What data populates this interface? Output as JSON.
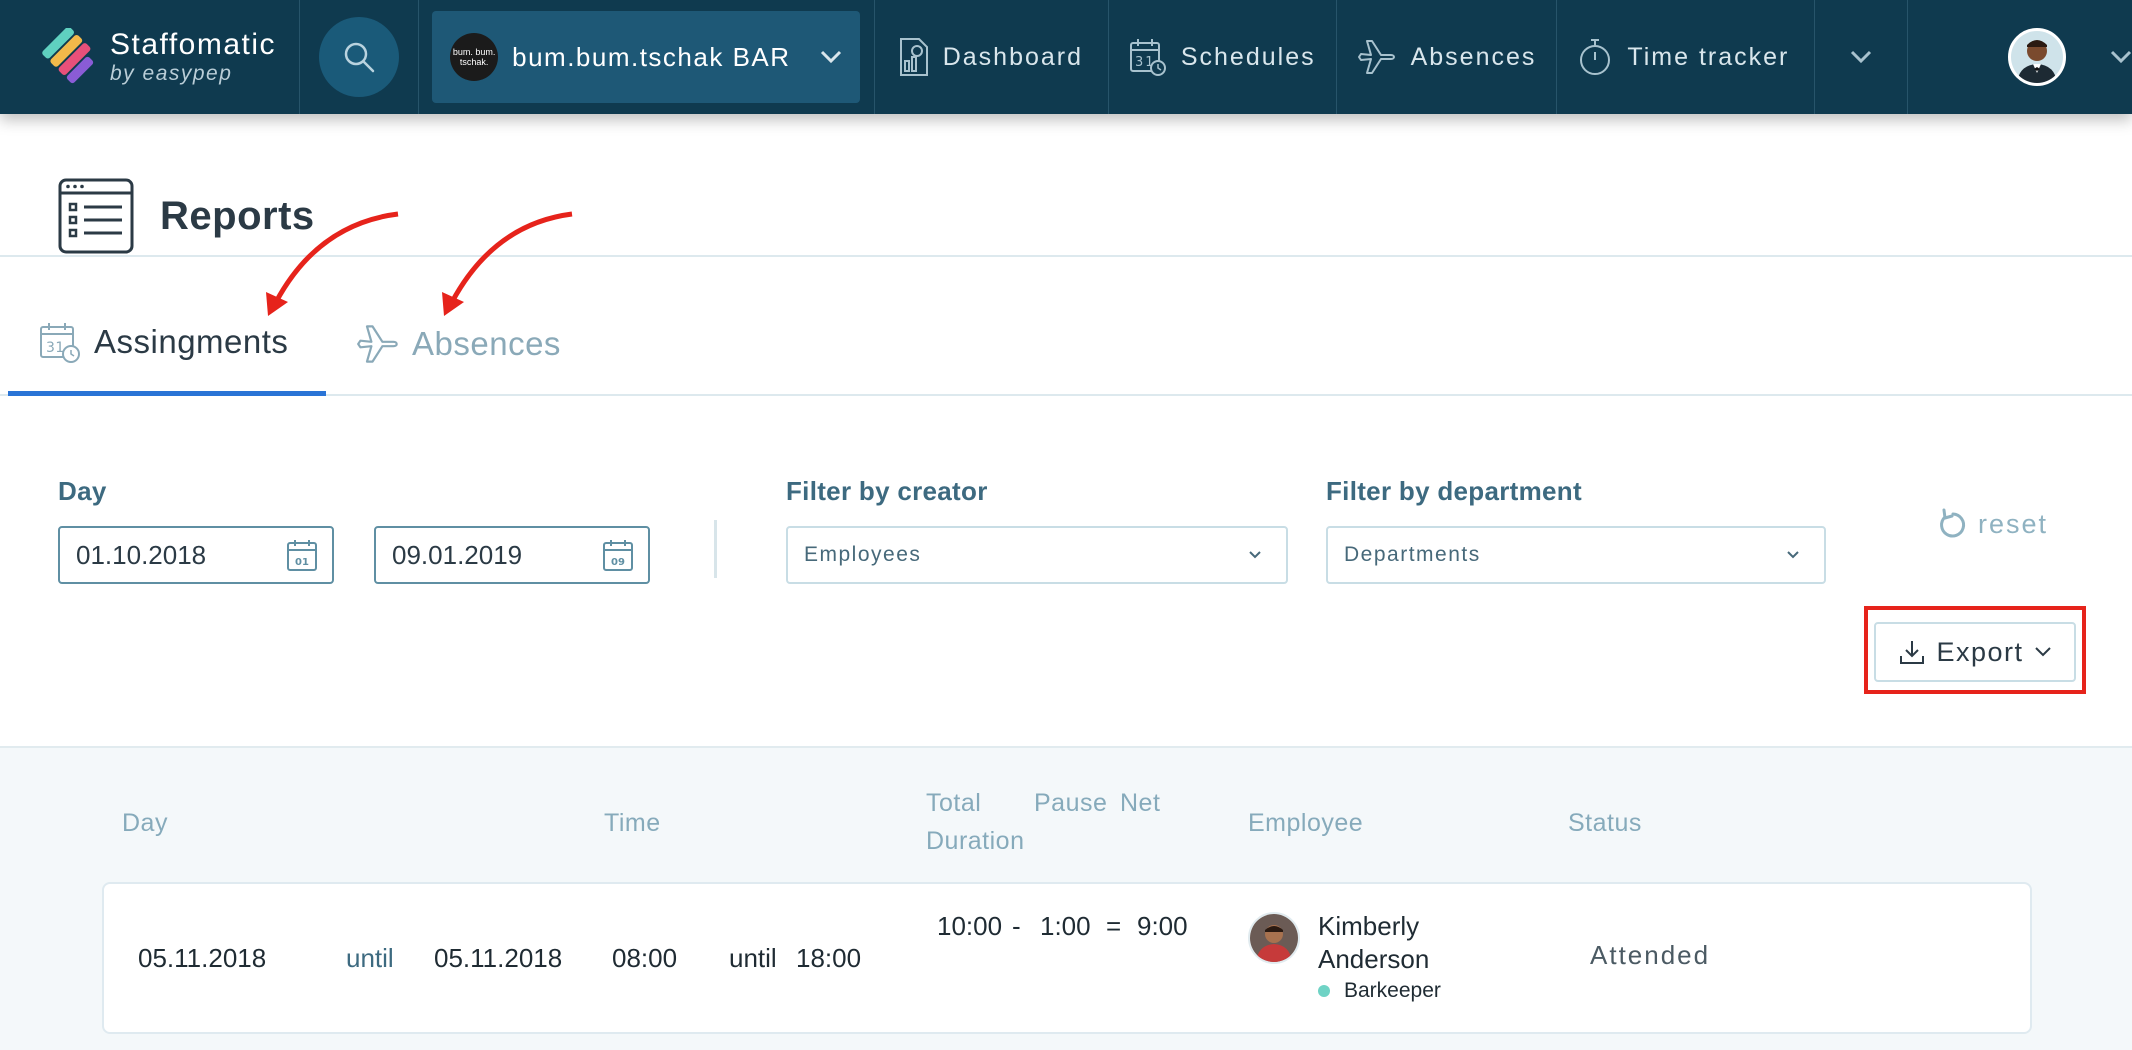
{
  "app": {
    "brand_name": "Staffomatic",
    "brand_sub": "by easypep",
    "organization": "bum.bum.tschak BAR",
    "organization_avatar_text": "bum. bum. tschak."
  },
  "nav": {
    "items": [
      {
        "label": "Dashboard",
        "icon": "dashboard-icon"
      },
      {
        "label": "Schedules",
        "icon": "calendar-icon"
      },
      {
        "label": "Absences",
        "icon": "airplane-icon"
      },
      {
        "label": "Time tracker",
        "icon": "stopwatch-icon"
      }
    ]
  },
  "page": {
    "title": "Reports"
  },
  "tabs": [
    {
      "label": "Assingments",
      "active": true
    },
    {
      "label": "Absences",
      "active": false
    }
  ],
  "filters": {
    "day_label": "Day",
    "date_from": "01.10.2018",
    "date_from_icon_day": "01",
    "date_to": "09.01.2019",
    "date_to_icon_day": "09",
    "creator_label": "Filter by creator",
    "creator_value": "Employees",
    "department_label": "Filter by department",
    "department_value": "Departments",
    "reset_label": "reset",
    "export_label": "Export"
  },
  "table": {
    "headers": {
      "day": "Day",
      "time": "Time",
      "total_1": "Total",
      "total_2": "Duration",
      "pause": "Pause",
      "net": "Net",
      "employee": "Employee",
      "status": "Status"
    },
    "rows": [
      {
        "start_day": "05.11.2018",
        "until_1": "until",
        "end_day": "05.11.2018",
        "start_time": "08:00",
        "until_2": "until",
        "end_time": "18:00",
        "total": "10:00",
        "minus": "-",
        "pause": "1:00",
        "equals": "=",
        "net": "9:00",
        "employee_first": "Kimberly",
        "employee_last": "Anderson",
        "position": "Barkeeper",
        "status": "Attended"
      }
    ]
  },
  "colors": {
    "navbar": "#0f3a4f",
    "active_tab": "#2a74d6",
    "highlight": "#e6231b",
    "position_dot": "#6fd3c5"
  }
}
